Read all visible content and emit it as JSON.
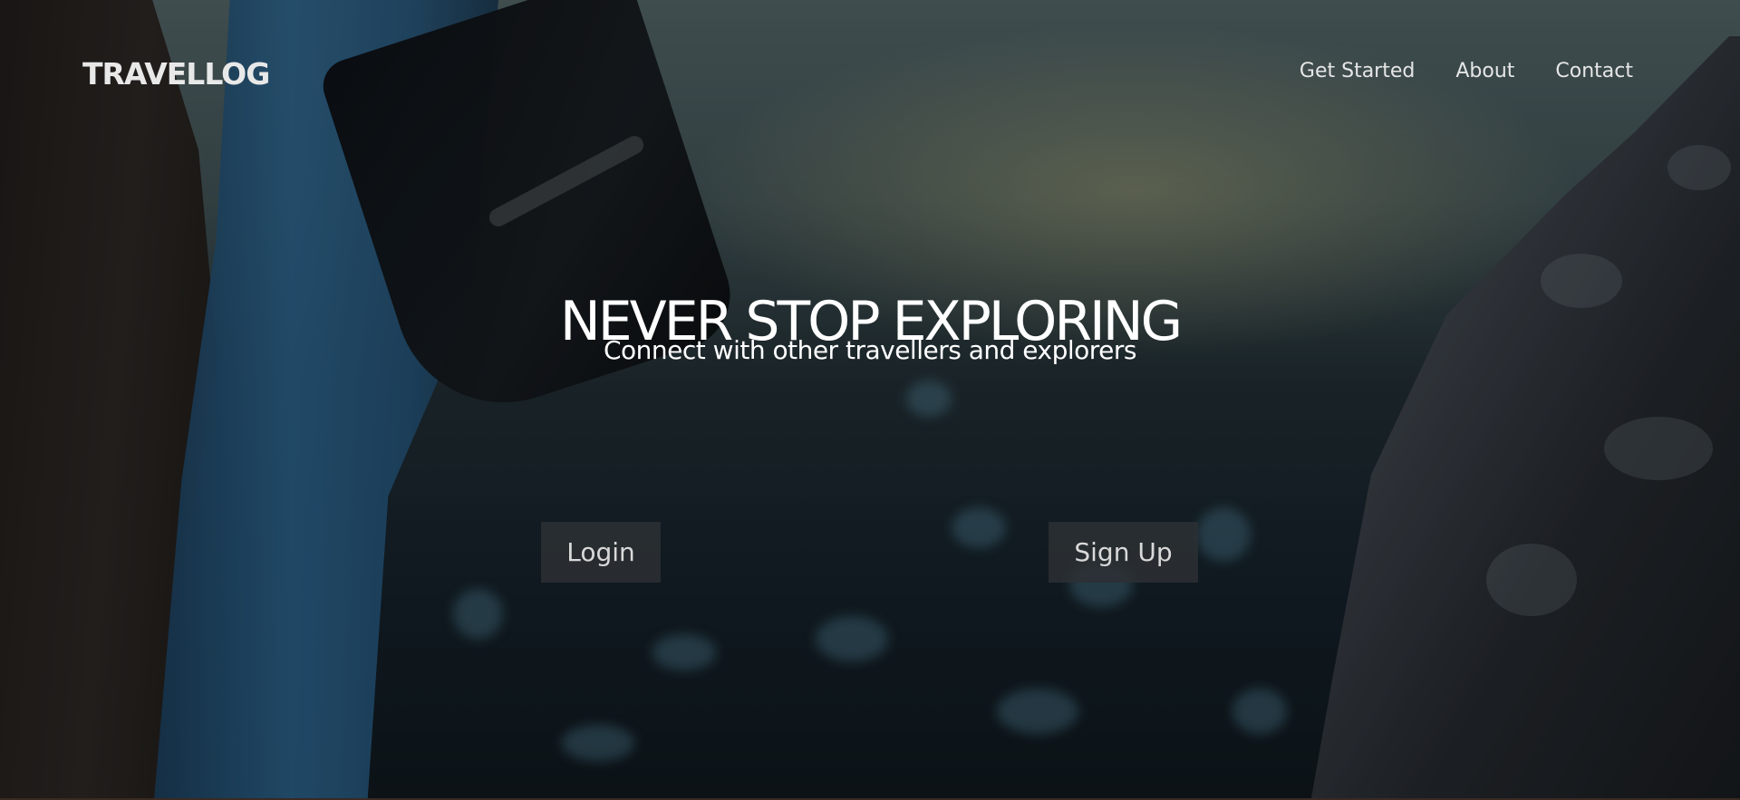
{
  "brand": {
    "logo": "TRAVELLOG"
  },
  "nav": {
    "items": [
      {
        "label": "Get Started"
      },
      {
        "label": "About"
      },
      {
        "label": "Contact"
      }
    ]
  },
  "hero": {
    "title": "NEVER STOP EXPLORING",
    "subtitle": "Connect with other travellers and explorers",
    "login_label": "Login",
    "signup_label": "Sign Up"
  }
}
